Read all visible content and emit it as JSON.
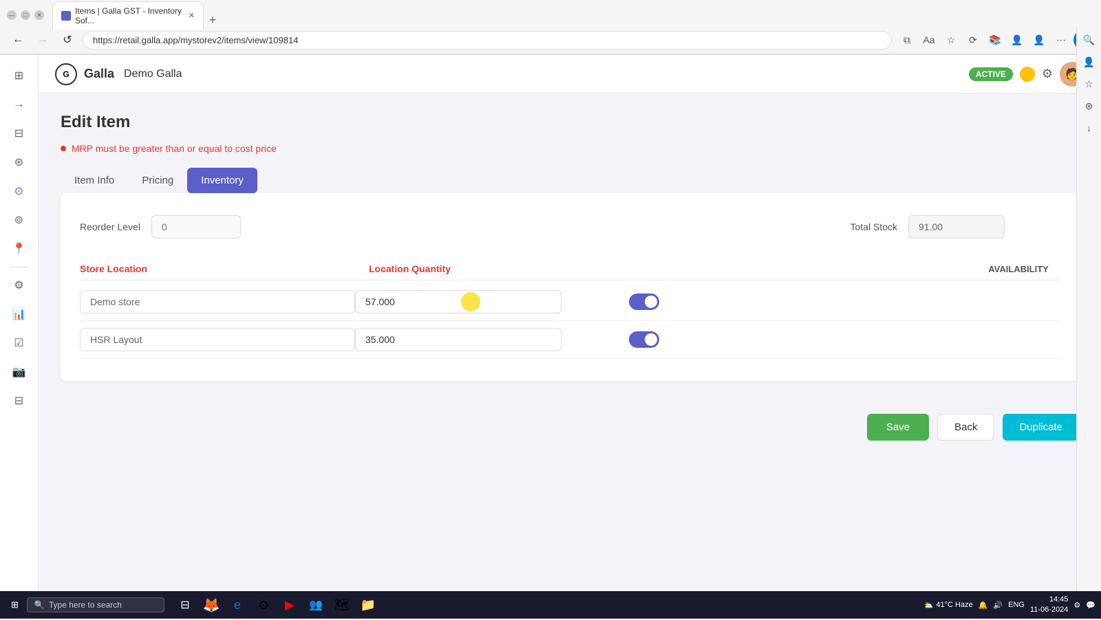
{
  "browser": {
    "tab_title": "Items | Galla GST - Inventory Sof...",
    "url": "https://retail.galla.app/mystorev2/items/view/109814",
    "new_tab_label": "+"
  },
  "app": {
    "logo_icon": "G",
    "logo_name": "Galla",
    "store_name": "Demo Galla",
    "active_badge": "ACTIVE",
    "settings_icon": "⚙"
  },
  "page": {
    "title": "Edit Item",
    "error_message": "MRP must be greater than or equal to cost price"
  },
  "tabs": [
    {
      "id": "item-info",
      "label": "Item Info"
    },
    {
      "id": "pricing",
      "label": "Pricing"
    },
    {
      "id": "inventory",
      "label": "Inventory"
    }
  ],
  "active_tab": "inventory",
  "form": {
    "reorder_level_label": "Reorder Level",
    "reorder_level_value": "",
    "reorder_level_placeholder": "0",
    "total_stock_label": "Total Stock",
    "total_stock_value": "91.00",
    "store_location_label": "Store Location",
    "location_quantity_label": "Location Quantity",
    "availability_label": "AVAILABILITY",
    "rows": [
      {
        "store": "Demo store",
        "quantity": "57.000",
        "available": true,
        "highlighted": true
      },
      {
        "store": "HSR Layout",
        "quantity": "35.000",
        "available": true,
        "highlighted": false
      }
    ]
  },
  "actions": {
    "save_label": "Save",
    "back_label": "Back",
    "duplicate_label": "Duplicate"
  },
  "taskbar": {
    "search_placeholder": "Type here to search",
    "time": "14:45",
    "date": "11-06-2024",
    "weather": "41°C Haze",
    "lang": "ENG"
  },
  "sidebar_icons": [
    {
      "name": "dashboard-icon",
      "symbol": "⊞"
    },
    {
      "name": "arrow-right-icon",
      "symbol": "→"
    },
    {
      "name": "folder-icon",
      "symbol": "⊟"
    },
    {
      "name": "tag-icon",
      "symbol": "⊛"
    },
    {
      "name": "person-icon",
      "symbol": "⊙"
    },
    {
      "name": "person2-icon",
      "symbol": "⊚"
    },
    {
      "name": "location-icon",
      "symbol": "⊜"
    },
    {
      "name": "settings2-icon",
      "symbol": "⚙"
    },
    {
      "name": "report-icon",
      "symbol": "⊠"
    },
    {
      "name": "checklist-icon",
      "symbol": "☑"
    },
    {
      "name": "camera-icon",
      "symbol": "⊡"
    },
    {
      "name": "table-icon",
      "symbol": "⊟"
    }
  ]
}
